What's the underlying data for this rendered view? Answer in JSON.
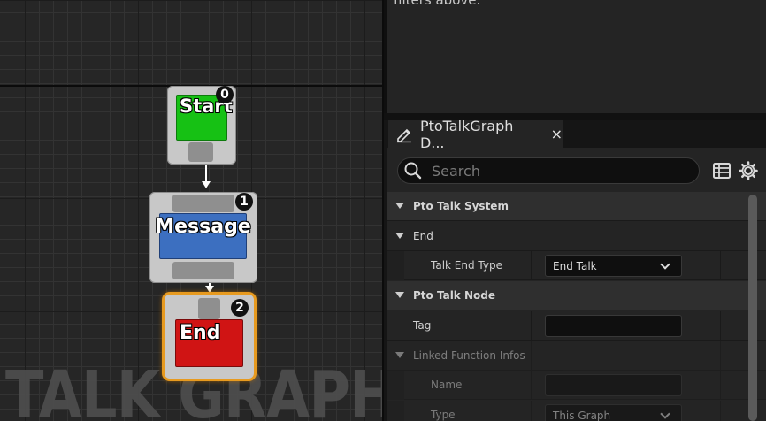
{
  "graph": {
    "watermark": "TALK GRAPH",
    "nodes": [
      {
        "label": "Start",
        "index": "0",
        "color": "#16c114"
      },
      {
        "label": "Message",
        "index": "1",
        "color": "#3c6fc0"
      },
      {
        "label": "End",
        "index": "2",
        "color": "#d01414"
      }
    ]
  },
  "top_panel": {
    "text": "filters above."
  },
  "details": {
    "tab_label": "PtoTalkGraph D...",
    "tab_close": "×",
    "search_placeholder": "Search",
    "sections": {
      "pto_talk_system": "Pto Talk System",
      "end": "End",
      "talk_end_type_label": "Talk End Type",
      "talk_end_type_value": "End Talk",
      "pto_talk_node": "Pto Talk Node",
      "tag_label": "Tag",
      "tag_value": "",
      "linked_function_infos": "Linked Function Infos",
      "name_label": "Name",
      "name_value": "",
      "type_label": "Type",
      "type_value": "This Graph"
    }
  },
  "colors": {
    "accent_selected": "#e79a1f",
    "panel_bg": "#242424",
    "graph_bg": "#262626"
  }
}
